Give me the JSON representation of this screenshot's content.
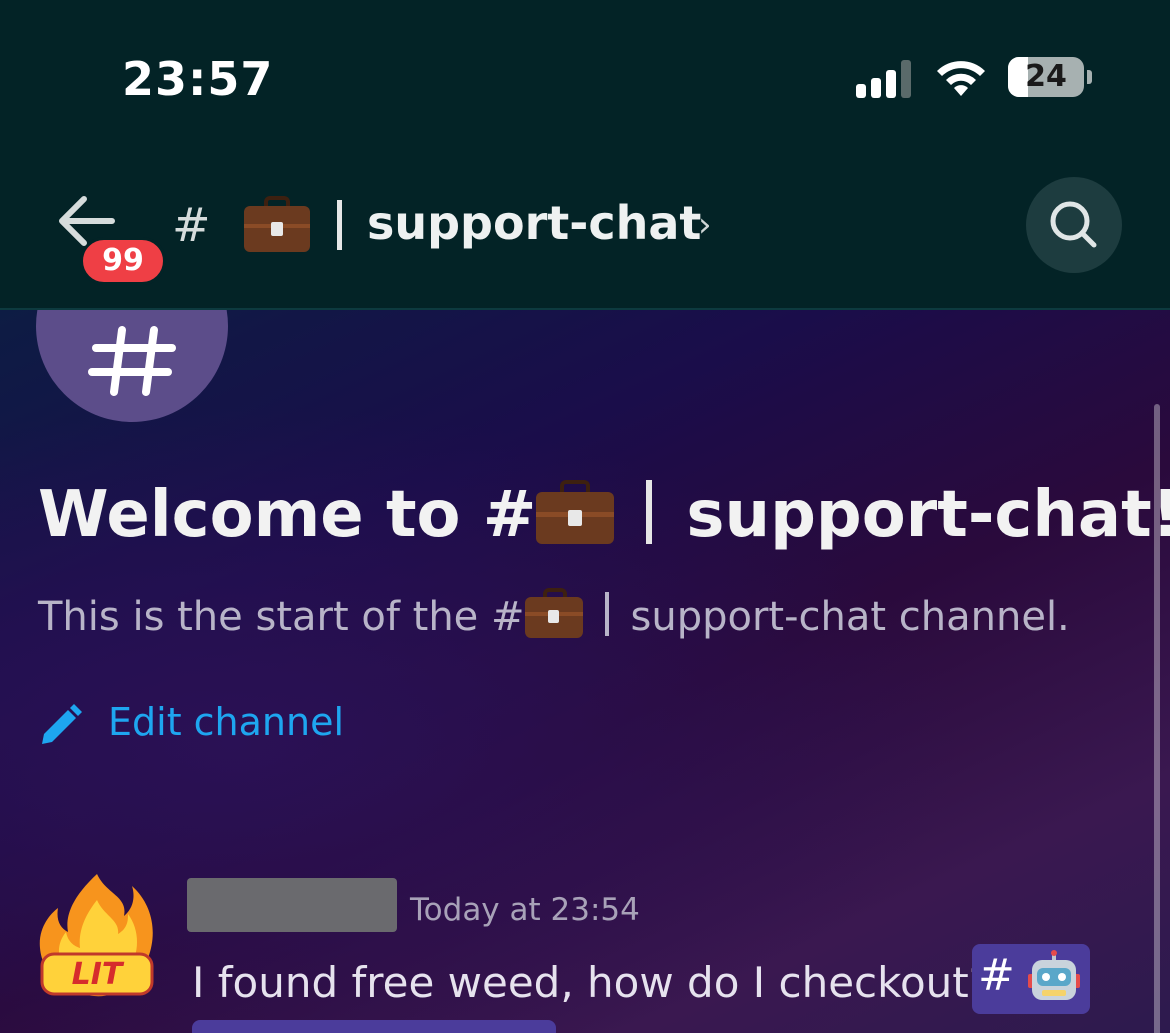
{
  "status_bar": {
    "time": "23:57",
    "battery": "24"
  },
  "header": {
    "unread_badge": "99",
    "hash": "#",
    "channel_name": "support-chat",
    "chevron": "›",
    "search_icon": "search-icon",
    "back_icon": "arrow-left-icon"
  },
  "channel_intro": {
    "hash_glyph": "#",
    "welcome_prefix": "Welcome to #",
    "welcome_suffix": "support-chat!",
    "subtitle_prefix": "This is the start of the #",
    "subtitle_suffix": "support-chat channel.",
    "edit_label": "Edit channel"
  },
  "message": {
    "avatar_text": "LIT",
    "timestamp": "Today at 23:54",
    "text": "I found free weed, how do I checkout?",
    "mention_hash": "#"
  },
  "colors": {
    "header_bg": "#032326",
    "badge": "#ef3f45",
    "link": "#1ea6f0",
    "mention_bg": "#4b3c9b"
  }
}
